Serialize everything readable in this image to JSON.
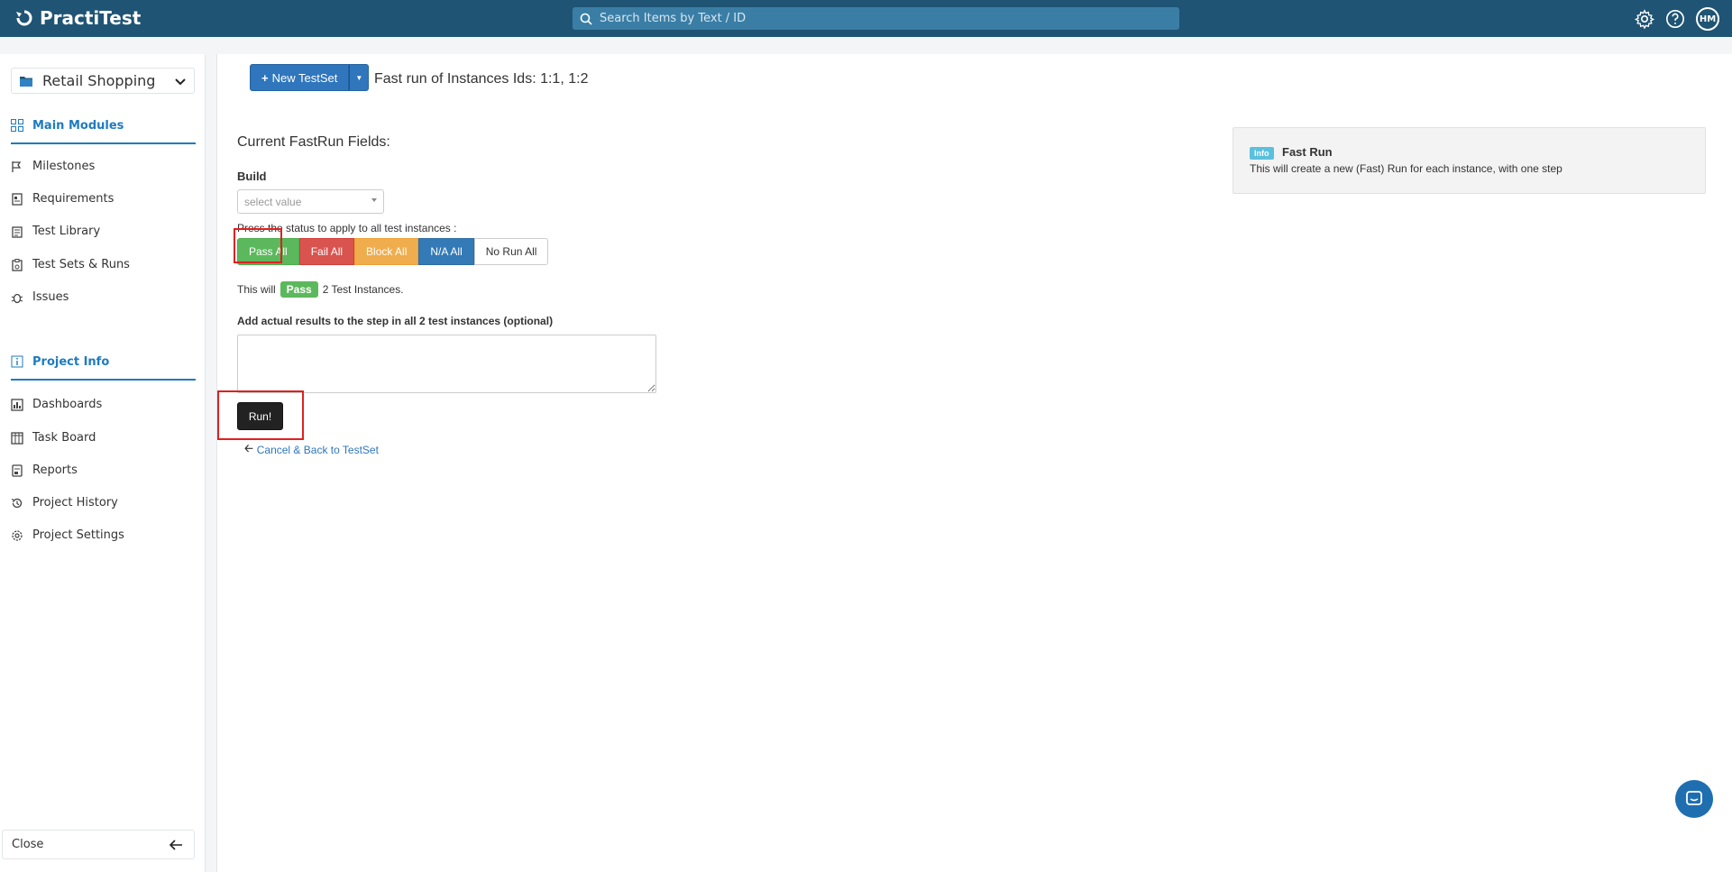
{
  "brand": {
    "name": "PractiTest"
  },
  "search": {
    "placeholder": "Search Items by Text / ID"
  },
  "user": {
    "initials": "HM"
  },
  "sidebar": {
    "project": "Retail Shopping",
    "main_modules_label": "Main Modules",
    "main_items": [
      {
        "label": "Milestones",
        "icon": "flag-icon"
      },
      {
        "label": "Requirements",
        "icon": "requirements-icon"
      },
      {
        "label": "Test Library",
        "icon": "test-library-icon"
      },
      {
        "label": "Test Sets & Runs",
        "icon": "test-sets-icon"
      },
      {
        "label": "Issues",
        "icon": "bug-icon"
      }
    ],
    "project_info_label": "Project Info",
    "info_items": [
      {
        "label": "Dashboards",
        "icon": "dashboard-icon"
      },
      {
        "label": "Task Board",
        "icon": "taskboard-icon"
      },
      {
        "label": "Reports",
        "icon": "reports-icon"
      },
      {
        "label": "Project History",
        "icon": "history-icon"
      },
      {
        "label": "Project Settings",
        "icon": "settings-icon"
      }
    ],
    "close_label": "Close"
  },
  "main": {
    "new_testset_label": "New TestSet",
    "title": "Fast run of Instances Ids: 1:1, 1:2",
    "section_title": "Current FastRun Fields:",
    "build_label": "Build",
    "build_placeholder": "select value",
    "status_hint": "Press the status to apply to all test instances :",
    "status_buttons": {
      "pass": "Pass All",
      "fail": "Fail All",
      "block": "Block All",
      "na": "N/A All",
      "norun": "No Run All"
    },
    "will_prefix": "This will",
    "will_badge": "Pass",
    "will_suffix": "2 Test Instances.",
    "actual_label": "Add actual results to the step in all 2 test instances (optional)",
    "actual_value": "",
    "run_label": "Run!",
    "back_label": "Cancel & Back to TestSet"
  },
  "info": {
    "badge": "Info",
    "title": "Fast Run",
    "description": "This will create a new (Fast) Run for each instance, with one step"
  },
  "colors": {
    "topbar": "#1f5474",
    "accent": "#1f7bbf",
    "pass": "#5cb85c",
    "fail": "#d9534f",
    "block": "#f0ad4e",
    "na": "#337ab7",
    "highlight": "#e02020"
  }
}
